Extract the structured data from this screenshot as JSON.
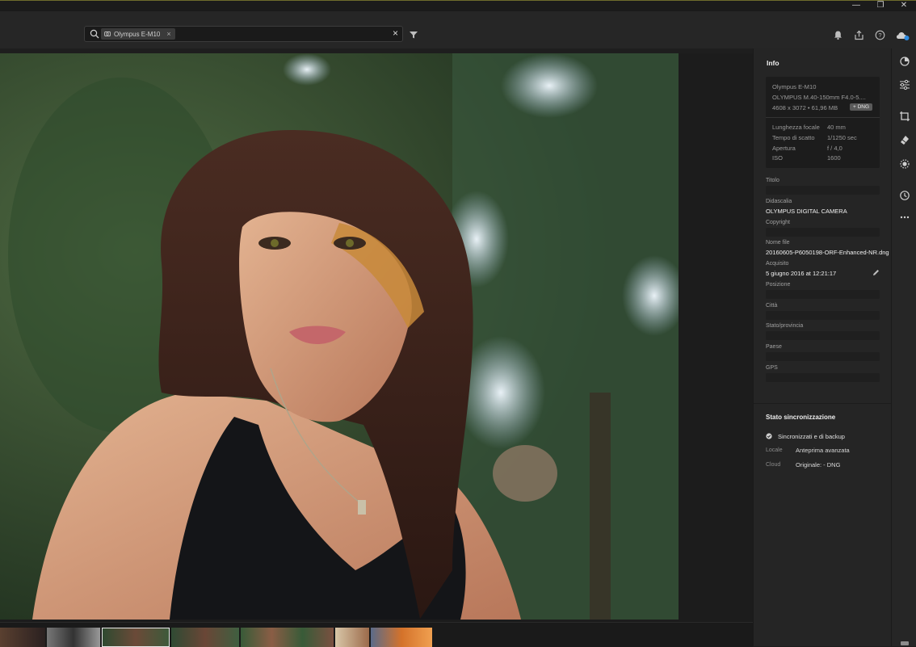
{
  "window_controls": [
    "—",
    "❐",
    "✕"
  ],
  "search": {
    "chip_label": "Olympus E-M10",
    "chip_remove": "×",
    "clear": "×"
  },
  "info": {
    "title": "Info",
    "camera": "Olympus E-M10",
    "lens": "OLYMPUS M.40-150mm F4.0-5....",
    "dimensions": "4608 x 3072  •  61,96 MB",
    "badge": "+ DNG",
    "exif": [
      {
        "label": "Lunghezza focale",
        "value": "40 mm"
      },
      {
        "label": "Tempo di scatto",
        "value": "1/1250 sec"
      },
      {
        "label": "Apertura",
        "value": "f / 4,0"
      },
      {
        "label": "ISO",
        "value": "1600"
      }
    ],
    "fields": {
      "titolo_label": "Titolo",
      "titolo_value": "",
      "didascalia_label": "Didascalia",
      "didascalia_value": "OLYMPUS DIGITAL CAMERA",
      "copyright_label": "Copyright",
      "copyright_value": "",
      "nomefile_label": "Nome file",
      "nomefile_value": "20160605-P6050198-ORF-Enhanced-NR.dng",
      "acquisito_label": "Acquisito",
      "acquisito_value": "5 giugno 2016 at 12:21:17",
      "posizione_label": "Posizione",
      "citta_label": "Città",
      "stato_label": "Stato/provincia",
      "paese_label": "Paese",
      "gps_label": "GPS"
    }
  },
  "sync": {
    "title": "Stato sincronizzazione",
    "status": "Sincronizzati e di backup",
    "local_label": "Locale",
    "local_value": "Anteprima avanzata",
    "cloud_label": "Cloud",
    "cloud_value": "Originale:  - DNG"
  },
  "filmstrip": {
    "selected_index": 2,
    "count": 7
  }
}
